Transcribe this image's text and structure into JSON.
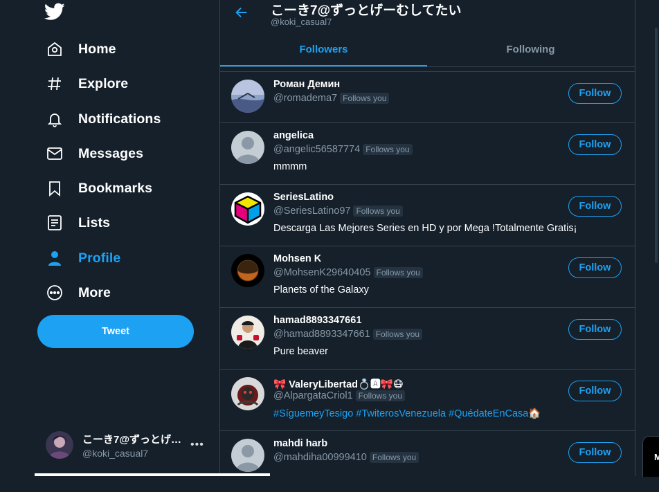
{
  "sidebar": {
    "nav": [
      {
        "label": "Home",
        "icon": "home-icon"
      },
      {
        "label": "Explore",
        "icon": "hashtag-icon"
      },
      {
        "label": "Notifications",
        "icon": "bell-icon"
      },
      {
        "label": "Messages",
        "icon": "envelope-icon"
      },
      {
        "label": "Bookmarks",
        "icon": "bookmark-icon"
      },
      {
        "label": "Lists",
        "icon": "list-icon"
      },
      {
        "label": "Profile",
        "icon": "user-icon"
      },
      {
        "label": "More",
        "icon": "more-circle-icon"
      }
    ],
    "tweet_label": "Tweet",
    "account": {
      "name": "こーき7@ずっとげ…",
      "handle": "@koki_casual7"
    }
  },
  "header": {
    "title": "こーき7@ずっとげーむしてたい",
    "handle": "@koki_casual7"
  },
  "tabs": [
    {
      "label": "Followers"
    },
    {
      "label": "Following"
    }
  ],
  "followers": [
    {
      "name": "Роман Демин",
      "handle": "@romadema7",
      "badge": "Follows you",
      "bio": "",
      "button": "Follow"
    },
    {
      "name": "angelica",
      "handle": "@angelic56587774",
      "badge": "Follows you",
      "bio": "mmmm",
      "button": "Follow"
    },
    {
      "name": "SeriesLatino",
      "handle": "@SeriesLatino97",
      "badge": "Follows you",
      "bio": "Descarga Las Mejores Series en HD y por Mega !Totalmente Gratis¡",
      "button": "Follow"
    },
    {
      "name": "Mohsen K",
      "handle": "@MohsenK29640405",
      "badge": "Follows you",
      "bio": "Planets of the Galaxy",
      "button": "Follow"
    },
    {
      "name": "hamad8893347661",
      "handle": "@hamad8893347661",
      "badge": "Follows you",
      "bio": "Pure beaver",
      "button": "Follow"
    },
    {
      "name": "🎀 ValeryLibertad💍🅰🎀😷",
      "handle": "@AlpargataCriol1",
      "badge": "Follows you",
      "bio": "#SíguemeyTesigo #TwiterosVenezuela #QuédateEnCasa🏠",
      "button": "Follow"
    },
    {
      "name": "mahdi harb",
      "handle": "@mahdiha00999410",
      "badge": "Follows you",
      "bio": "",
      "button": "Follow"
    }
  ],
  "colors": {
    "background": "#15202b",
    "accent": "#1da1f2",
    "border": "#38444d",
    "muted": "#8899a6"
  }
}
